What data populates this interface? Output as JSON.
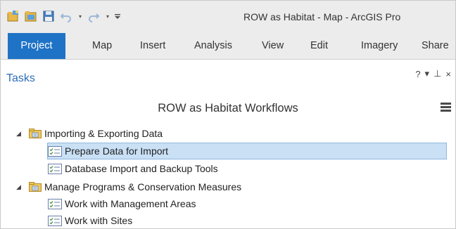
{
  "window": {
    "title": "ROW as Habitat - Map - ArcGIS Pro"
  },
  "quick_access": {
    "icons": [
      "new-project-icon",
      "open-project-icon",
      "save-project-icon",
      "undo-icon",
      "redo-icon",
      "customize-toolbar-icon"
    ]
  },
  "ribbon": {
    "tabs": [
      {
        "label": "Project",
        "active": true
      },
      {
        "label": "Map"
      },
      {
        "label": "Insert"
      },
      {
        "label": "Analysis"
      },
      {
        "label": "View"
      },
      {
        "label": "Edit"
      },
      {
        "label": "Imagery"
      },
      {
        "label": "Share"
      }
    ]
  },
  "tasks_pane": {
    "title": "Tasks",
    "controls": {
      "help": "?",
      "menu": "▾",
      "pin": "⊥",
      "close": "×"
    },
    "workflow_title": "ROW as Habitat Workflows",
    "groups": [
      {
        "label": "Importing & Exporting Data",
        "expanded": true,
        "tasks": [
          {
            "label": "Prepare Data for Import",
            "selected": true
          },
          {
            "label": "Database Import and Backup Tools"
          }
        ]
      },
      {
        "label": "Manage Programs & Conservation Measures",
        "expanded": true,
        "tasks": [
          {
            "label": "Work with Management Areas"
          },
          {
            "label": "Work with Sites"
          }
        ]
      }
    ]
  },
  "colors": {
    "accent": "#1f73c6",
    "selection": "#c9e0f5",
    "pane_title": "#2e6fb6"
  }
}
